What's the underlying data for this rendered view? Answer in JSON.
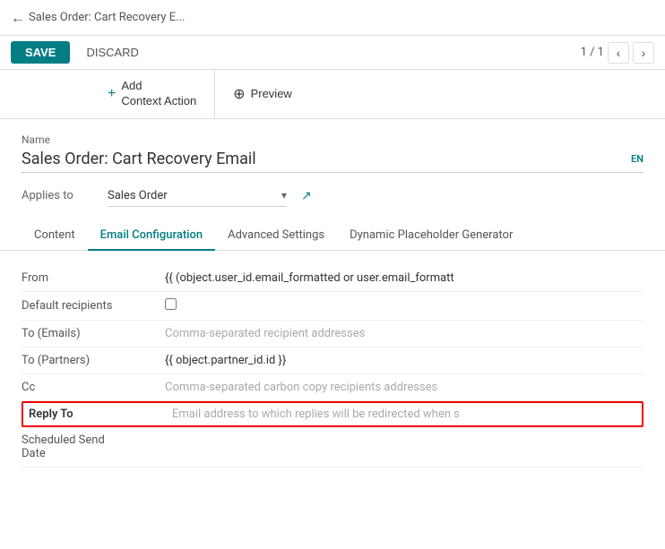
{
  "topbar": {
    "back_label": "Sales Order: Cart Recovery E..."
  },
  "actionbar": {
    "save_label": "SAVE",
    "discard_label": "DISCARD",
    "pagination": "1 / 1"
  },
  "toolbar": {
    "add_context_action_label": "Add\nContext Action",
    "preview_label": "Preview"
  },
  "form": {
    "name_label": "Name",
    "name_value": "Sales Order: Cart Recovery Email",
    "lang_badge": "EN",
    "applies_to_label": "Applies to",
    "applies_to_value": "Sales Order"
  },
  "tabs": [
    {
      "id": "content",
      "label": "Content",
      "active": false
    },
    {
      "id": "email-configuration",
      "label": "Email Configuration",
      "active": true
    },
    {
      "id": "advanced-settings",
      "label": "Advanced Settings",
      "active": false
    },
    {
      "id": "dynamic-placeholder",
      "label": "Dynamic Placeholder Generator",
      "active": false
    }
  ],
  "fields": [
    {
      "label": "From",
      "value": "{{ (object.user_id.email_formatted or user.email_formatt",
      "placeholder": false,
      "bold": false,
      "type": "text"
    },
    {
      "label": "Default recipients",
      "value": "",
      "placeholder": false,
      "bold": false,
      "type": "checkbox"
    },
    {
      "label": "To (Emails)",
      "value": "Comma-separated recipient addresses",
      "placeholder": true,
      "bold": false,
      "type": "text"
    },
    {
      "label": "To (Partners)",
      "value": "{{ object.partner_id.id }}",
      "placeholder": false,
      "bold": false,
      "type": "text"
    },
    {
      "label": "Cc",
      "value": "Comma-separated carbon copy recipients addresses",
      "placeholder": true,
      "bold": false,
      "type": "text"
    },
    {
      "label": "Reply To",
      "value": "Email address to which replies will be redirected when s",
      "placeholder": true,
      "bold": true,
      "type": "text",
      "highlighted": true
    },
    {
      "label": "Scheduled Send\nDate",
      "value": "",
      "placeholder": true,
      "bold": false,
      "type": "text"
    }
  ]
}
